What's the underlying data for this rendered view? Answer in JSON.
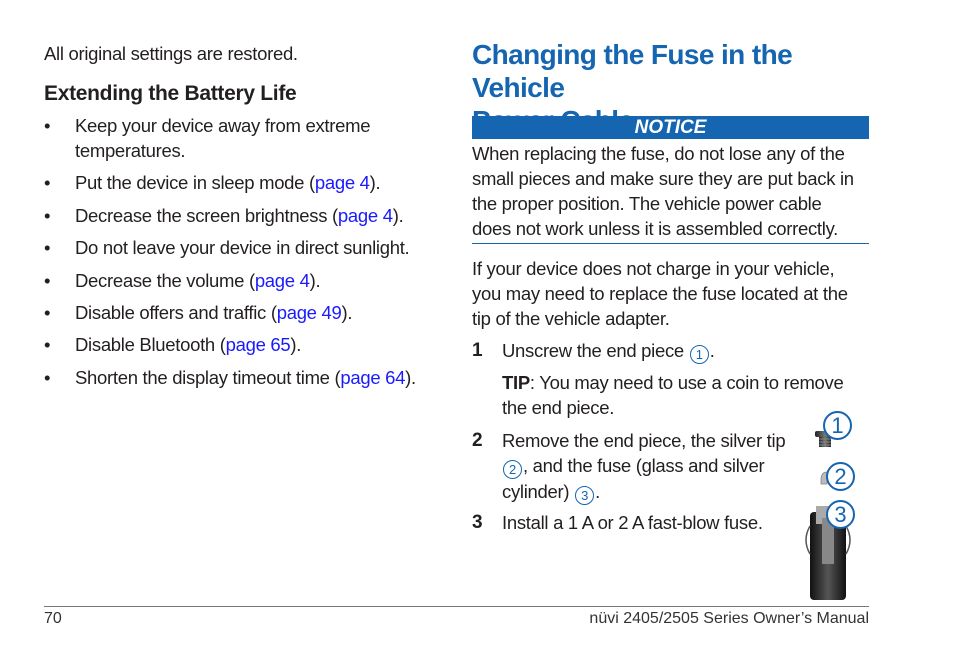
{
  "left_column": {
    "intro": "All original settings are restored.",
    "heading": "Extending the Battery Life",
    "bullet_char": "•",
    "bullets": [
      {
        "line1": "Keep your device away from extreme",
        "line2": "temperatures.",
        "pre": "",
        "link": "",
        "post": ""
      },
      {
        "pre": "Put the device in sleep mode (",
        "link": "page 4",
        "post": ")."
      },
      {
        "pre": "Decrease the screen brightness (",
        "link": "page 4",
        "post": ")."
      },
      {
        "pre": "Do not leave your device in direct sunlight.",
        "link": "",
        "post": ""
      },
      {
        "pre": "Decrease the volume (",
        "link": "page 4",
        "post": ")."
      },
      {
        "pre": "Disable offers and traffic (",
        "link": "page 49",
        "post": ")."
      },
      {
        "pre": "Disable Bluetooth (",
        "link": "page 65",
        "post": ")."
      },
      {
        "pre": "Shorten the display timeout time (",
        "link": "page 64",
        "post": ")."
      }
    ]
  },
  "right_column": {
    "title_line1": "Changing the Fuse in the Vehicle",
    "title_line2": "Power Cable",
    "notice_label": "NOTICE",
    "notice_lines": [
      "When replacing the fuse, do not lose any of the",
      "small pieces and make sure they are put back in",
      "the proper position. The vehicle power cable",
      "does not work unless it is assembled correctly."
    ],
    "para_lines": [
      "If your device does not charge in your vehicle,",
      "you may need to replace the fuse located at the",
      "tip of the vehicle adapter."
    ],
    "steps": [
      {
        "num": "1",
        "text": "Unscrew the end piece",
        "callout": "1",
        "end": "."
      },
      {
        "num": "2",
        "line1": "Remove the end piece, the silver tip",
        "callout_a": "2",
        "line2": ", and the fuse (glass and silver",
        "line3": "cylinder)",
        "callout_b": "3",
        "end": "."
      },
      {
        "num": "3",
        "text": "Install a 1 A or 2 A fast-blow fuse."
      }
    ],
    "tip_label": "TIP",
    "tip_line1": ": You may need to use a coin to remove",
    "tip_line2": "the end piece.",
    "figure_callouts": [
      "1",
      "2",
      "3"
    ]
  },
  "footer": {
    "page_number": "70",
    "manual_title": "nüvi 2405/2505 Series Owner’s Manual"
  }
}
